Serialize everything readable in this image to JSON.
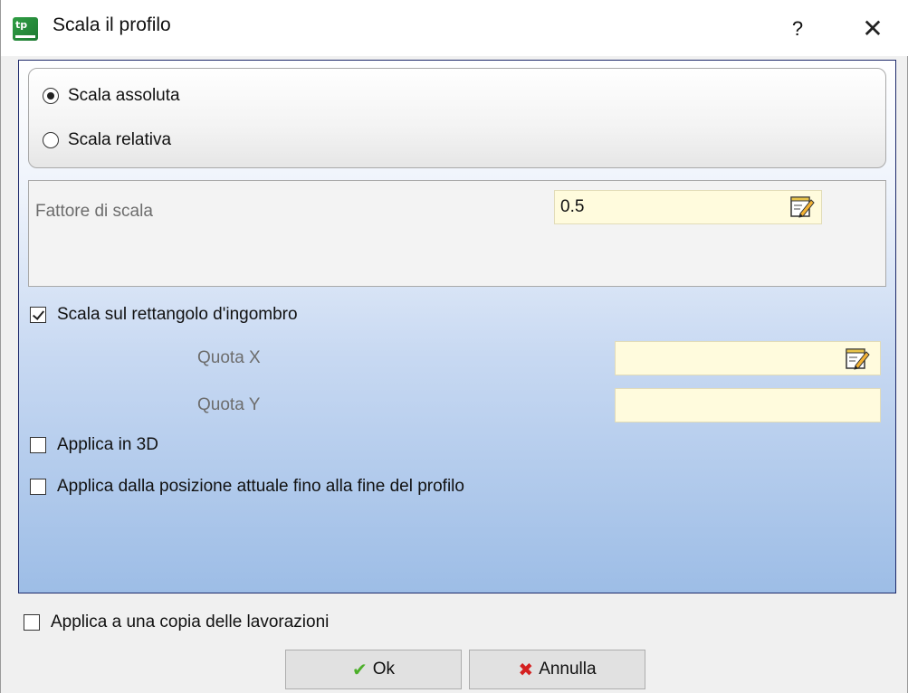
{
  "window": {
    "title": "Scala il profilo",
    "help_label": "?",
    "close_label": "✕"
  },
  "scale_mode": {
    "options": [
      {
        "label": "Scala assoluta",
        "checked": true
      },
      {
        "label": "Scala relativa",
        "checked": false
      }
    ]
  },
  "factor": {
    "label": "Fattore di scala",
    "value": "0.5"
  },
  "bounding": {
    "label": "Scala sul rettangolo d'ingombro",
    "checked": true,
    "quota_x_label": "Quota X",
    "quota_x_value": "",
    "quota_y_label": "Quota Y",
    "quota_y_value": ""
  },
  "options": {
    "apply_3d": {
      "label": "Applica in 3D",
      "checked": false
    },
    "apply_from_position": {
      "label": "Applica dalla posizione attuale fino alla fine del profilo",
      "checked": false
    }
  },
  "copy_option": {
    "label": "Applica a una copia delle lavorazioni",
    "checked": false
  },
  "buttons": {
    "ok_label": "Ok",
    "cancel_label": "Annulla"
  },
  "colors": {
    "field_bg": "#fffbdd",
    "panel_border": "#1e2a6b",
    "gradient_bottom": "#9dbde6",
    "ok_green": "#4caf2a",
    "cancel_red": "#d42020"
  }
}
